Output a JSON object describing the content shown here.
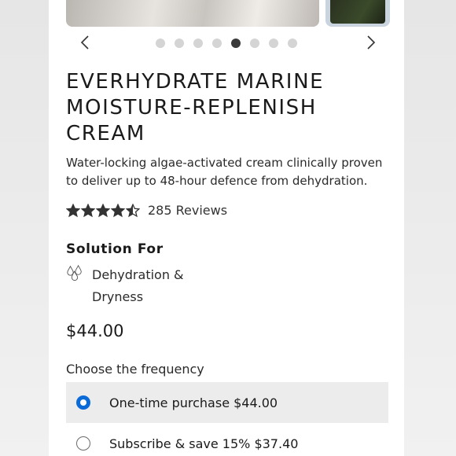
{
  "gallery": {
    "prev_icon": "chevron-left-icon",
    "next_icon": "chevron-right-icon",
    "dot_count": 8,
    "active_dot": 5
  },
  "product": {
    "title": "EVERHYDRATE MARINE MOISTURE-REPLENISH CREAM",
    "description": "Water-locking algae-activated cream clinically proven to deliver up to 48-hour defence from dehydration.",
    "rating": 4.5,
    "reviews_label": "285 Reviews",
    "solution_heading": "Solution For",
    "solution_icon": "water-drops-icon",
    "solution_item": "Dehydration & Dryness",
    "price": "$44.00"
  },
  "frequency": {
    "label": "Choose the frequency",
    "options": [
      {
        "label": "One-time purchase $44.00",
        "selected": true
      },
      {
        "label": "Subscribe & save 15% $37.40",
        "selected": false
      }
    ]
  },
  "colors": {
    "accent": "#0a6bd8",
    "selected_bg": "#ececec",
    "active_dot": "#3a3a3a",
    "inactive_dot": "#d4d4d4"
  }
}
